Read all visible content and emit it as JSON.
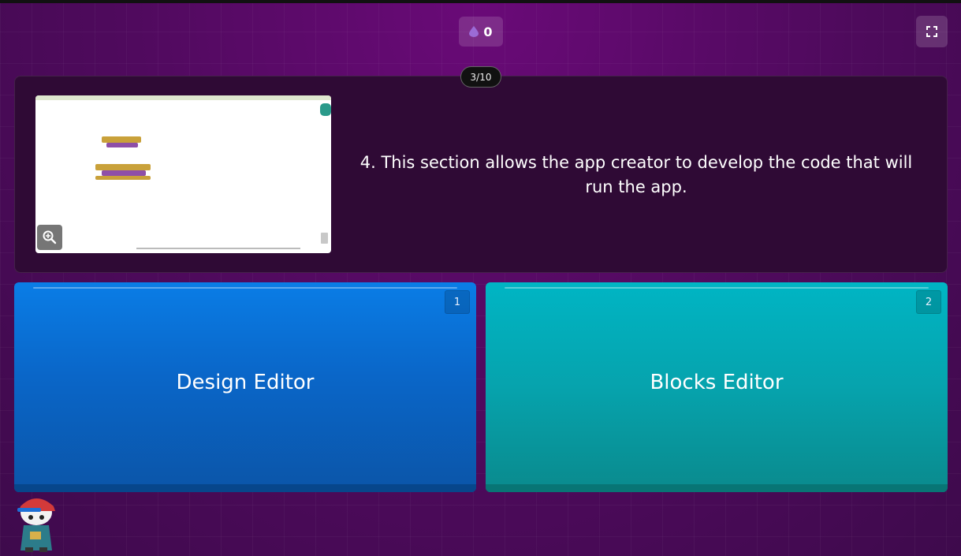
{
  "header": {
    "score": "0",
    "score_icon": "drop-icon",
    "fullscreen_icon": "fullscreen-icon"
  },
  "question": {
    "progress": "3/10",
    "text": "4. This section allows the app creator to develop the code that will run the app.",
    "zoom_icon": "zoom-in-icon"
  },
  "options": [
    {
      "number": "1",
      "label": "Design Editor",
      "color": "#0a6fd6"
    },
    {
      "number": "2",
      "label": "Blocks Editor",
      "color": "#03a8b3"
    }
  ],
  "colors": {
    "background": "#4e0a5c",
    "card": "#2f0a35"
  }
}
